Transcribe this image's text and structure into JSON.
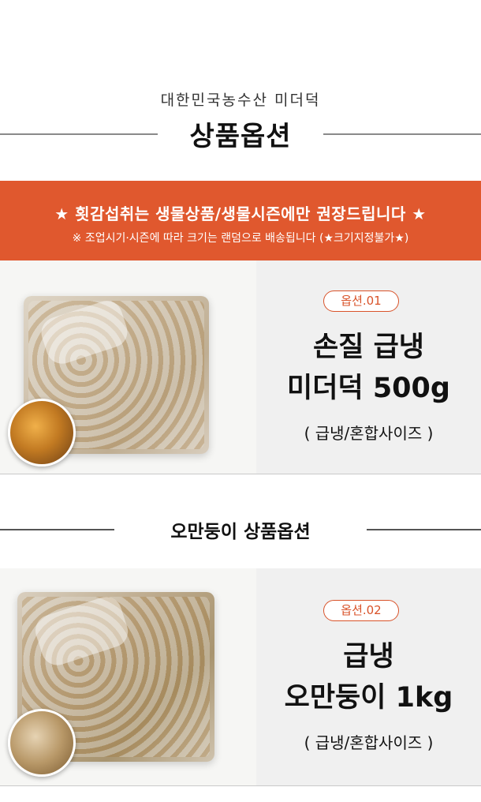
{
  "header": {
    "origin": "대한민국농수산 미더덕",
    "title": "상품옵션"
  },
  "banner": {
    "main": "★ 횟감섭취는 생물상품/생물시즌에만 권장드립니다 ★",
    "sub": "※ 조업시기·시즌에 따라 크기는 랜덤으로 배송됩니다 (★크기지정불가★)"
  },
  "products": [
    {
      "badge": "옵션.01",
      "name_line1": "손질 급냉",
      "name_line2": "미더덕 500g",
      "size": "( 급냉/혼합사이즈 )"
    },
    {
      "badge": "옵션.02",
      "name_line1": "급냉",
      "name_line2": "오만둥이 1kg",
      "size": "( 급냉/혼합사이즈 )"
    }
  ],
  "section": {
    "title": "오만둥이 상품옵션"
  },
  "colors": {
    "accent": "#e0582e",
    "badge": "#d9532a"
  }
}
